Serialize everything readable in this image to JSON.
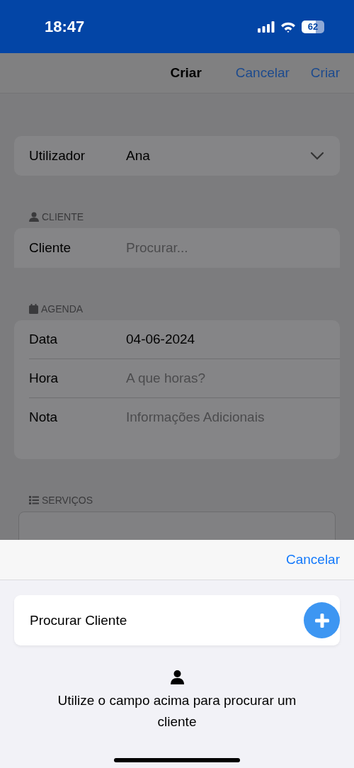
{
  "status_bar": {
    "time": "18:47",
    "battery": "62"
  },
  "nav": {
    "title": "Criar",
    "cancel": "Cancelar",
    "create": "Criar"
  },
  "user_field": {
    "label": "Utilizador",
    "value": "Ana"
  },
  "sections": [
    {
      "kind": "person",
      "title": "CLIENTE",
      "rows": [
        {
          "label": "Cliente",
          "placeholder": "Procurar..."
        }
      ]
    },
    {
      "kind": "calendar",
      "title": "AGENDA",
      "rows": [
        {
          "label": "Data",
          "value": "04-06-2024"
        },
        {
          "label": "Hora",
          "placeholder": "A que horas?"
        },
        {
          "label": "Nota",
          "placeholder": "Informações Adicionais"
        }
      ]
    },
    {
      "kind": "list",
      "title": "SERVIÇOS"
    }
  ],
  "sheet": {
    "cancel": "Cancelar",
    "search_placeholder": "Procurar Cliente",
    "empty_message": "Utilize o campo acima para procurar um cliente"
  }
}
